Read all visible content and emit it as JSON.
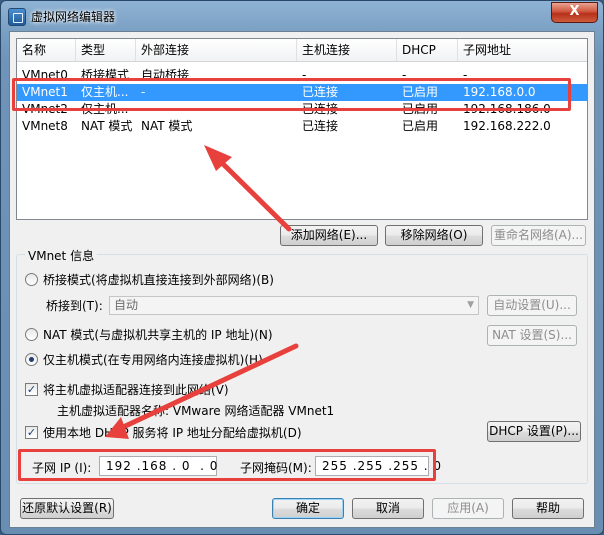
{
  "window": {
    "title": "虚拟网络编辑器",
    "close_glyph": "X"
  },
  "table": {
    "columns": [
      "名称",
      "类型",
      "外部连接",
      "主机连接",
      "DHCP",
      "子网地址"
    ],
    "rows": [
      [
        "VMnet0",
        "桥接模式",
        "自动桥接",
        "-",
        "-",
        "-"
      ],
      [
        "VMnet1",
        "仅主机...",
        "-",
        "已连接",
        "已启用",
        "192.168.0.0"
      ],
      [
        "VMnet2",
        "仅主机...",
        "-",
        "已连接",
        "已启用",
        "192.168.186.0"
      ],
      [
        "VMnet8",
        "NAT 模式",
        "NAT 模式",
        "已连接",
        "已启用",
        "192.168.222.0"
      ]
    ],
    "selected_row": "VMnet1"
  },
  "list_buttons": {
    "add": "添加网络(E)...",
    "remove": "移除网络(O)",
    "rename": "重命名网络(A)..."
  },
  "vmnet_info": {
    "title": "VMnet 信息",
    "bridge_radio": "桥接模式(将虚拟机直接连接到外部网络)(B)",
    "bridge_to_label": "桥接到(T):",
    "bridge_to_value": "自动",
    "auto_settings": "自动设置(U)...",
    "nat_radio": "NAT 模式(与虚拟机共享主机的 IP 地址)(N)",
    "nat_settings": "NAT 设置(S)...",
    "hostonly_radio": "仅主机模式(在专用网络内连接虚拟机)(H)",
    "selected_mode": "hostonly",
    "connect_adapter_check": "将主机虚拟适配器连接到此网络(V)",
    "connect_adapter_checked": true,
    "adapter_name": "主机虚拟适配器名称: VMware 网络适配器 VMnet1",
    "dhcp_check": "使用本地 DHCP 服务将 IP 地址分配给虚拟机(D)",
    "dhcp_checked": true,
    "dhcp_settings": "DHCP 设置(P)...",
    "subnet_ip_label": "子网 IP (I):",
    "subnet_ip": "192 .168 . 0  . 0",
    "subnet_mask_label": "子网掩码(M):",
    "subnet_mask": "255 .255 .255 . 0"
  },
  "footer": {
    "restore": "还原默认设置(R)",
    "ok": "确定",
    "cancel": "取消",
    "apply": "应用(A)",
    "help": "帮助"
  },
  "colors": {
    "selection": "#3399ff",
    "annotation": "#e8403c"
  }
}
